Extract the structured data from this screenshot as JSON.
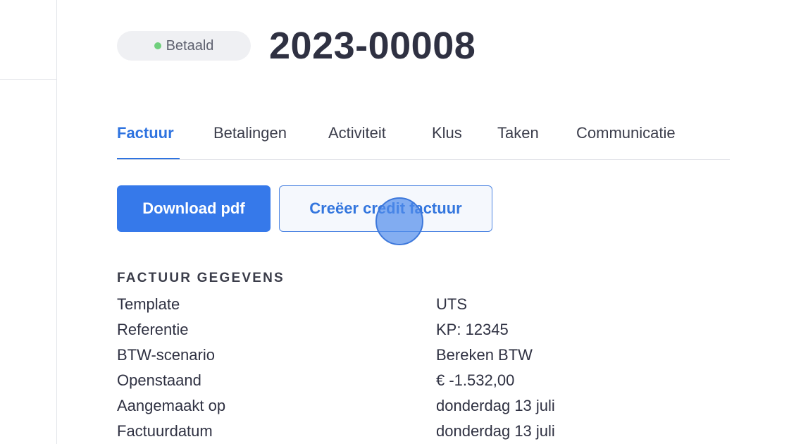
{
  "status": {
    "label": "Betaald",
    "dot_color": "#6fcf7c"
  },
  "invoice": {
    "number": "2023-00008"
  },
  "tabs": [
    {
      "label": "Factuur",
      "active": true
    },
    {
      "label": "Betalingen",
      "active": false
    },
    {
      "label": "Activiteit",
      "active": false
    },
    {
      "label": "Klus",
      "active": false
    },
    {
      "label": "Taken",
      "active": false
    },
    {
      "label": "Communicatie",
      "active": false
    }
  ],
  "actions": {
    "download_label": "Download pdf",
    "credit_label": "Creëer credit factuur"
  },
  "details": {
    "title": "FACTUUR GEGEVENS",
    "rows": [
      {
        "label": "Template",
        "value": "UTS"
      },
      {
        "label": "Referentie",
        "value": "KP: 12345"
      },
      {
        "label": "BTW-scenario",
        "value": "Bereken BTW"
      },
      {
        "label": "Openstaand",
        "value": "€ -1.532,00"
      },
      {
        "label": "Aangemaakt op",
        "value": "donderdag 13 juli"
      },
      {
        "label": "Factuurdatum",
        "value": "donderdag 13 juli"
      }
    ]
  },
  "colors": {
    "accent": "#2e73e0",
    "primary_button": "#3679ea",
    "text": "#2f3142"
  }
}
